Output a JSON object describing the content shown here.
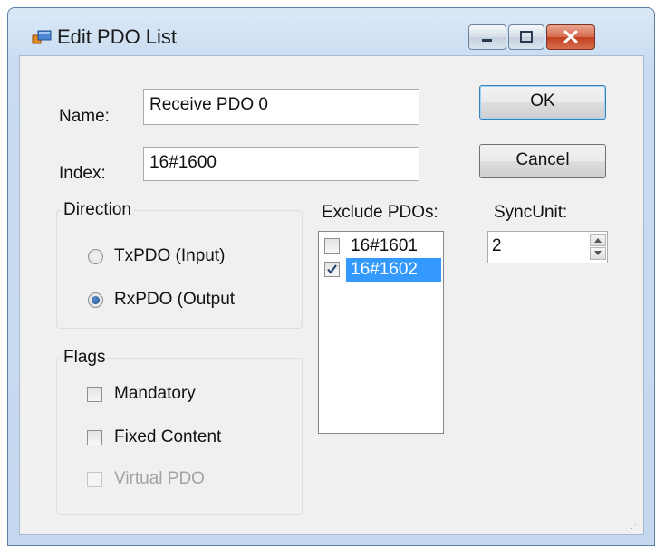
{
  "window": {
    "title": "Edit PDO List"
  },
  "titlebar_buttons": {
    "minimize": "minimize-icon",
    "maximize": "maximize-icon",
    "close": "close-icon"
  },
  "fields": {
    "name_label": "Name:",
    "name_value": "Receive PDO 0",
    "index_label": "Index:",
    "index_value": "16#1600"
  },
  "buttons": {
    "ok": "OK",
    "cancel": "Cancel"
  },
  "direction": {
    "title": "Direction",
    "options": [
      {
        "label": "TxPDO (Input)",
        "checked": false
      },
      {
        "label": "RxPDO (Output",
        "checked": true
      }
    ]
  },
  "flags": {
    "title": "Flags",
    "items": [
      {
        "label": "Mandatory",
        "checked": false,
        "enabled": true
      },
      {
        "label": "Fixed Content",
        "checked": false,
        "enabled": true
      },
      {
        "label": "Virtual PDO",
        "checked": false,
        "enabled": false
      }
    ]
  },
  "exclude": {
    "label": "Exclude PDOs:",
    "items": [
      {
        "label": "16#1601",
        "checked": false,
        "selected": false
      },
      {
        "label": "16#1602",
        "checked": true,
        "selected": true
      }
    ]
  },
  "syncunit": {
    "label": "SyncUnit:",
    "value": "2"
  },
  "colors": {
    "selection": "#3399ff",
    "title_bar": "#c4d8ef",
    "close_button": "#c1401f"
  }
}
